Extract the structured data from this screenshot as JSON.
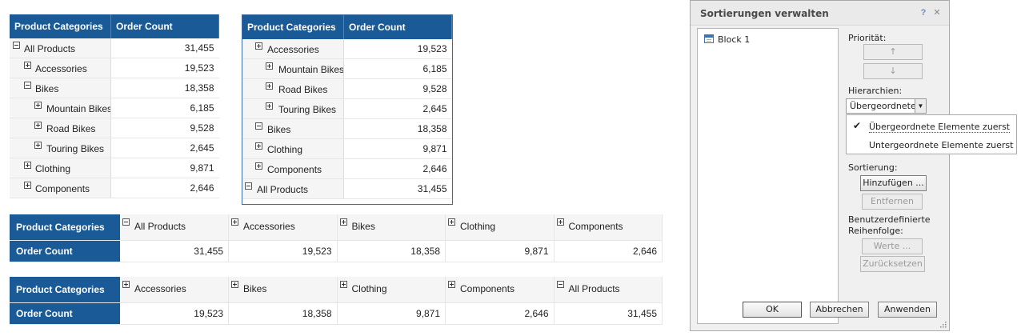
{
  "table_vertical_1": {
    "headers": [
      "Product Categories",
      "Order Count"
    ],
    "rows": [
      {
        "label": "All Products",
        "value": "31,455",
        "toggle": "minus"
      },
      {
        "label": "Accessories",
        "value": "19,523",
        "toggle": "plus"
      },
      {
        "label": "Bikes",
        "value": "18,358",
        "toggle": "minus"
      },
      {
        "label": "Mountain Bikes",
        "value": "6,185",
        "toggle": "plus"
      },
      {
        "label": "Road Bikes",
        "value": "9,528",
        "toggle": "plus"
      },
      {
        "label": "Touring Bikes",
        "value": "2,645",
        "toggle": "plus"
      },
      {
        "label": "Clothing",
        "value": "9,871",
        "toggle": "plus"
      },
      {
        "label": "Components",
        "value": "2,646",
        "toggle": "plus"
      }
    ]
  },
  "table_vertical_2": {
    "headers": [
      "Product Categories",
      "Order Count"
    ],
    "rows": [
      {
        "label": "Accessories",
        "value": "19,523",
        "toggle": "plus"
      },
      {
        "label": "Mountain Bikes",
        "value": "6,185",
        "toggle": "plus"
      },
      {
        "label": "Road Bikes",
        "value": "9,528",
        "toggle": "plus"
      },
      {
        "label": "Touring Bikes",
        "value": "2,645",
        "toggle": "plus"
      },
      {
        "label": "Bikes",
        "value": "18,358",
        "toggle": "minus"
      },
      {
        "label": "Clothing",
        "value": "9,871",
        "toggle": "plus"
      },
      {
        "label": "Components",
        "value": "2,646",
        "toggle": "plus"
      },
      {
        "label": "All Products",
        "value": "31,455",
        "toggle": "minus"
      }
    ]
  },
  "table_horizontal_1": {
    "row_header_categories": "Product Categories",
    "row_header_count": "Order Count",
    "columns": [
      {
        "label": "All Products",
        "value": "31,455",
        "toggle": "minus"
      },
      {
        "label": "Accessories",
        "value": "19,523",
        "toggle": "plus"
      },
      {
        "label": "Bikes",
        "value": "18,358",
        "toggle": "plus"
      },
      {
        "label": "Clothing",
        "value": "9,871",
        "toggle": "plus"
      },
      {
        "label": "Components",
        "value": "2,646",
        "toggle": "plus"
      }
    ]
  },
  "table_horizontal_2": {
    "row_header_categories": "Product Categories",
    "row_header_count": "Order Count",
    "columns": [
      {
        "label": "Accessories",
        "value": "19,523",
        "toggle": "plus"
      },
      {
        "label": "Bikes",
        "value": "18,358",
        "toggle": "plus"
      },
      {
        "label": "Clothing",
        "value": "9,871",
        "toggle": "plus"
      },
      {
        "label": "Components",
        "value": "2,646",
        "toggle": "plus"
      },
      {
        "label": "All Products",
        "value": "31,455",
        "toggle": "minus"
      }
    ]
  },
  "dialog": {
    "title": "Sortierungen verwalten",
    "help_icon": "help-icon",
    "close_icon": "close-icon",
    "block_list": [
      {
        "label": "Block 1",
        "icon": "table-icon"
      }
    ],
    "priority_label": "Priorität:",
    "up_arrow": "↑",
    "down_arrow": "↓",
    "hierarchy_label": "Hierarchien:",
    "hierarchy_selected": "Übergeordnete...",
    "hierarchy_options": [
      "Übergeordnete Elemente zuerst",
      "Untergeordnete Elemente zuerst"
    ],
    "sort_label": "Sortierung:",
    "add_button": "Hinzufügen ...",
    "remove_button": "Entfernen",
    "custom_order_label_line1": "Benutzerdefinierte",
    "custom_order_label_line2": "Reihenfolge:",
    "values_button": "Werte ...",
    "reset_button": "Zurücksetzen",
    "ok_button": "OK",
    "cancel_button": "Abbrechen",
    "apply_button": "Anwenden"
  },
  "colors": {
    "header_blue": "#1a5a96",
    "cell_gray": "#f5f5f5",
    "dialog_bg": "#f0f0f0"
  }
}
